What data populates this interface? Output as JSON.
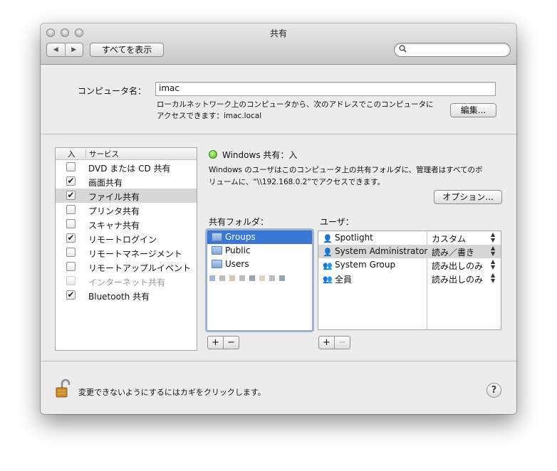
{
  "window": {
    "title": "共有"
  },
  "toolbar": {
    "back": "◀",
    "forward": "▶",
    "show_all": "すべてを表示",
    "search_placeholder": ""
  },
  "computer": {
    "name_label": "コンピュータ名：",
    "name_value": "imac",
    "info_line1": "ローカルネットワーク上のコンピュータから、次のアドレスでこのコンピュータに",
    "info_line2": "アクセスできます：imac.local",
    "edit_button": "編集..."
  },
  "services": {
    "header_on": "入",
    "header_service": "サービス",
    "items": [
      {
        "label": "DVD または CD 共有",
        "checked": false,
        "selected": false,
        "enabled": true
      },
      {
        "label": "画面共有",
        "checked": true,
        "selected": false,
        "enabled": true
      },
      {
        "label": "ファイル共有",
        "checked": true,
        "selected": true,
        "enabled": true
      },
      {
        "label": "プリンタ共有",
        "checked": false,
        "selected": false,
        "enabled": true
      },
      {
        "label": "スキャナ共有",
        "checked": false,
        "selected": false,
        "enabled": true
      },
      {
        "label": "リモートログイン",
        "checked": true,
        "selected": false,
        "enabled": true
      },
      {
        "label": "リモートマネージメント",
        "checked": false,
        "selected": false,
        "enabled": true
      },
      {
        "label": "リモートアップルイベント",
        "checked": false,
        "selected": false,
        "enabled": true
      },
      {
        "label": "インターネット共有",
        "checked": false,
        "selected": false,
        "enabled": false
      },
      {
        "label": "Bluetooth 共有",
        "checked": true,
        "selected": false,
        "enabled": true
      }
    ]
  },
  "status": {
    "title": "Windows 共有：入",
    "color": "#43a713",
    "desc_line1": "Windows のユーザはこのコンピュータ上の共有フォルダに、管理者はすべてのボ",
    "desc_line2": "リュームに、“\\\\192.168.0.2”でアクセスできます。",
    "options_button": "オプション..."
  },
  "folders": {
    "label": "共有フォルダ：",
    "items": [
      {
        "name": "Groups",
        "selected": true
      },
      {
        "name": "Public",
        "selected": false
      },
      {
        "name": "Users",
        "selected": false
      }
    ],
    "add": "+",
    "remove": "−"
  },
  "users": {
    "label": "ユーザ：",
    "rows": [
      {
        "name": "Spotlight",
        "permission": "カスタム",
        "icon": "single-user-icon",
        "selected": false
      },
      {
        "name": "System Administrator",
        "permission": "読み／書き",
        "icon": "single-user-icon",
        "selected": true
      },
      {
        "name": "System Group",
        "permission": "読み出しのみ",
        "icon": "group-icon",
        "selected": false
      },
      {
        "name": "全員",
        "permission": "読み出しのみ",
        "icon": "everyone-icon",
        "selected": false
      }
    ],
    "add": "+",
    "remove": "−"
  },
  "footer": {
    "lock_text": "変更できないようにするにはカギをクリックします。",
    "help": "?"
  }
}
